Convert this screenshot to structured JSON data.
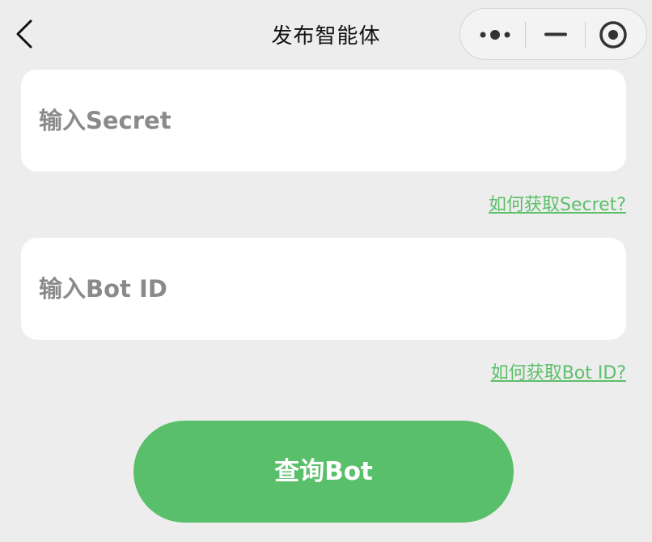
{
  "navbar": {
    "title": "发布智能体",
    "back_icon": "chevron-left-icon",
    "capsule": {
      "more_icon": "more-dots-icon",
      "minimize_icon": "minimize-icon",
      "close_icon": "target-circle-icon"
    }
  },
  "form": {
    "secret": {
      "placeholder": "输入Secret",
      "value": "",
      "help_link": "如何获取Secret? "
    },
    "bot_id": {
      "placeholder": "输入Bot ID",
      "value": "",
      "help_link": "如何获取Bot ID?"
    },
    "submit_label": "查询Bot"
  },
  "colors": {
    "accent": "#5abf6b",
    "link": "#5cbf6a",
    "background": "#ededed",
    "card": "#ffffff",
    "placeholder": "#8a8a8a"
  }
}
